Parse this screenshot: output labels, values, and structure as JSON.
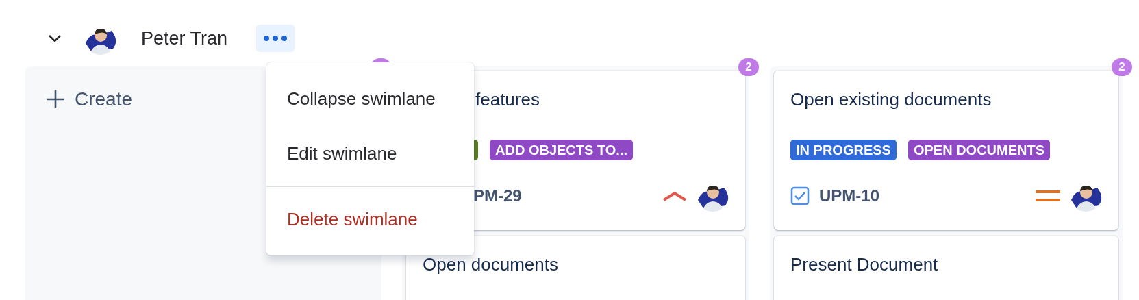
{
  "swimlane": {
    "name": "Peter Tran",
    "expanded": true,
    "menu_open": true
  },
  "menu": {
    "items": [
      {
        "label": "Collapse swimlane",
        "kind": "normal"
      },
      {
        "label": "Edit swimlane",
        "kind": "normal"
      },
      {
        "label": "Delete swimlane",
        "kind": "danger"
      }
    ]
  },
  "columns": [
    {
      "create_label": "Create"
    },
    {
      "count": "2",
      "cards": [
        {
          "title": "features",
          "covered": true,
          "tags": [
            {
              "color": "#5b7f24"
            },
            {
              "label": "ADD OBJECTS TO...",
              "color": "#8f49c4"
            }
          ],
          "key": "PM-29",
          "priority": {
            "kind": "high"
          }
        },
        {
          "title": "Open documents",
          "covered": false
        }
      ]
    },
    {
      "count": "2",
      "cards": [
        {
          "title": "Open existing documents",
          "covered": false,
          "tags": [
            {
              "label": "IN PROGRESS",
              "color": "#2f6ad8"
            },
            {
              "label": "OPEN DOCUMENTS",
              "color": "#8f49c4"
            }
          ],
          "key": "UPM-10",
          "priority": {
            "kind": "medium"
          }
        },
        {
          "title": "Present Document",
          "covered": false
        }
      ]
    }
  ]
}
